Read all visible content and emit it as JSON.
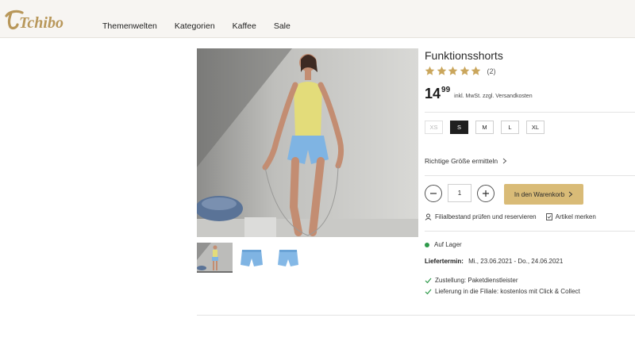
{
  "header": {
    "brand": "Tchibo",
    "nav": [
      "Themenwelten",
      "Kategorien",
      "Kaffee",
      "Sale"
    ]
  },
  "product": {
    "title": "Funktionsshorts",
    "rating": {
      "stars": 5,
      "max": 5,
      "count": "(2)"
    },
    "price": {
      "main": "14",
      "cents": "99",
      "note": "inkl. MwSt. zzgl. Versandkosten"
    },
    "sizes": [
      {
        "label": "XS",
        "state": "disabled"
      },
      {
        "label": "S",
        "state": "selected"
      },
      {
        "label": "M",
        "state": "available"
      },
      {
        "label": "L",
        "state": "available"
      },
      {
        "label": "XL",
        "state": "available"
      }
    ],
    "size_guide": "Richtige Größe ermitteln",
    "quantity": "1",
    "cart_button": "In den Warenkorb",
    "store_link": "Filialbestand prüfen und reservieren",
    "wishlist_link": "Artikel merken",
    "stock": "Auf Lager",
    "delivery": {
      "label": "Liefertermin:",
      "value": "Mi., 23.06.2021 - Do., 24.06.2021"
    },
    "shipping_lines": [
      "Zustellung: Paketdienstleister",
      "Lieferung in die Filiale: kostenlos mit Click & Collect"
    ]
  },
  "colors": {
    "accent": "#d9bb77",
    "brand": "#b8975a",
    "star": "#caa65c",
    "stock_green": "#2e9a4a",
    "shorts_blue": "#7fb4e3"
  },
  "icons": {
    "star": "star-icon",
    "chevron": "chevron-right-icon",
    "minus": "minus-icon",
    "plus": "plus-icon",
    "store": "store-icon",
    "bookmark": "bookmark-icon",
    "check": "check-icon"
  }
}
